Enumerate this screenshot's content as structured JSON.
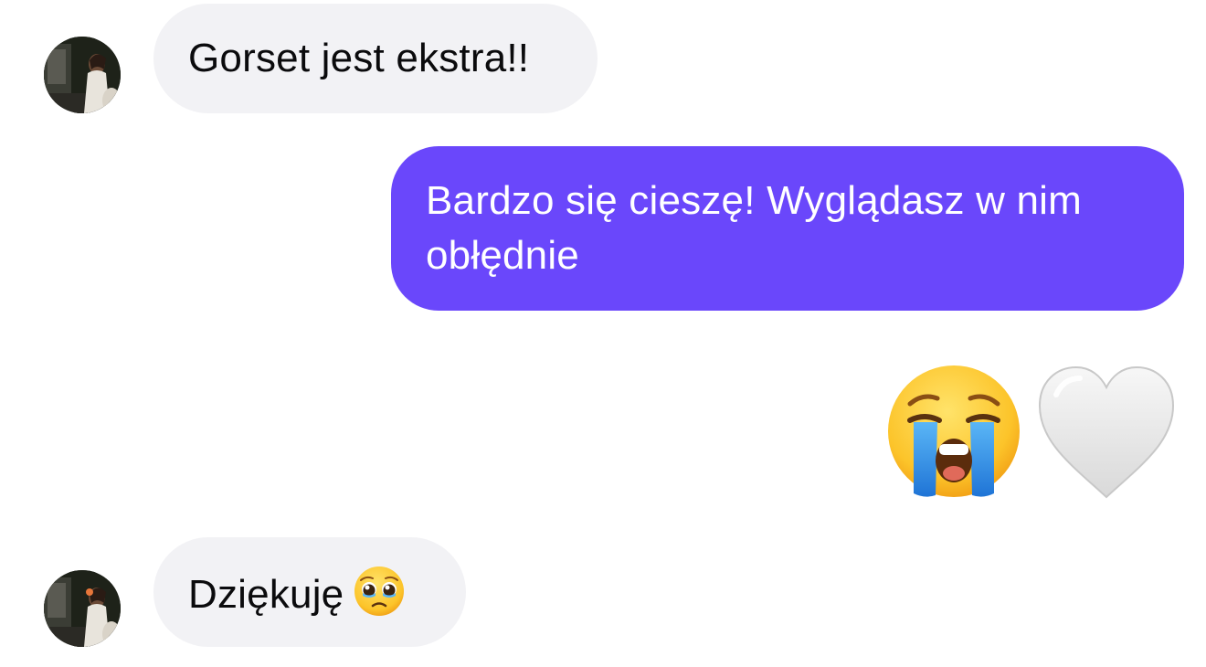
{
  "conversation": {
    "messages": [
      {
        "direction": "incoming",
        "text": "Gorset jest ekstra!!",
        "avatar_icon": "contact-avatar-photo"
      },
      {
        "direction": "outgoing",
        "text_line1": "Bardzo się cieszę! Wyglądasz w nim",
        "text_line2": "obłędnie"
      },
      {
        "direction": "outgoing",
        "emojis": [
          "loudly-crying-face-icon",
          "white-heart-icon"
        ]
      },
      {
        "direction": "incoming",
        "text": "Dziękuję",
        "emoji": "pleading-face-icon",
        "avatar_icon": "contact-avatar-photo"
      }
    ]
  },
  "colors": {
    "outgoing_bubble": "#6a47fb",
    "incoming_bubble": "#f2f2f5",
    "background": "#ffffff"
  }
}
